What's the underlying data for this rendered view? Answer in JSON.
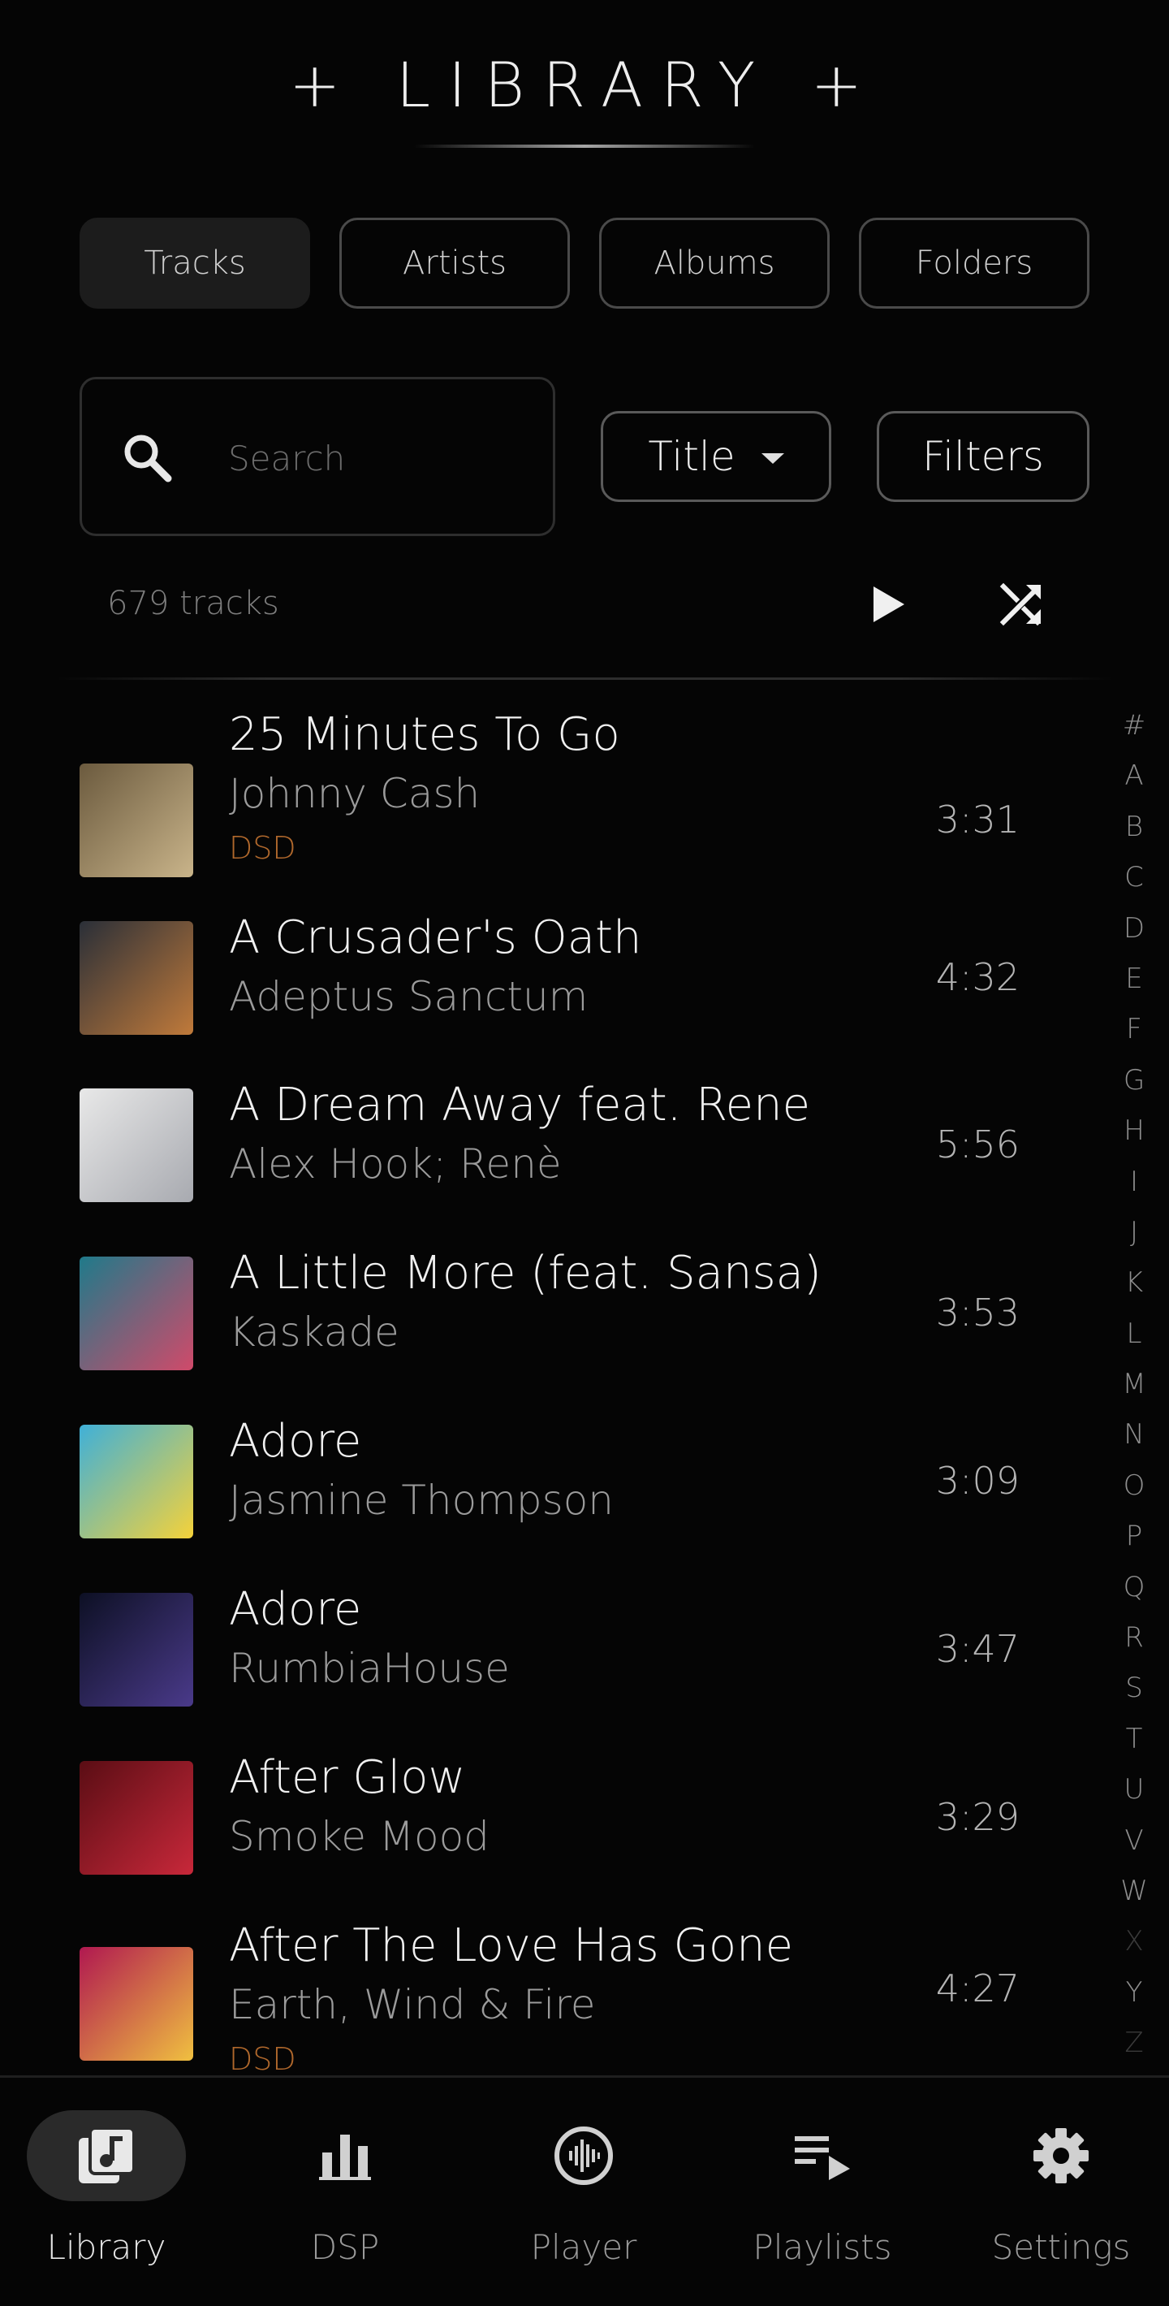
{
  "header": {
    "title": "+ LIBRARY +"
  },
  "tabs": [
    {
      "label": "Tracks",
      "active": true
    },
    {
      "label": "Artists",
      "active": false
    },
    {
      "label": "Albums",
      "active": false
    },
    {
      "label": "Folders",
      "active": false
    }
  ],
  "search": {
    "placeholder": "Search",
    "value": ""
  },
  "sort": {
    "label": "Title"
  },
  "filters": {
    "label": "Filters"
  },
  "summary": {
    "count_label": "679 tracks"
  },
  "tracks": [
    {
      "title": "25 Minutes To Go",
      "artist": "Johnny Cash",
      "badge": "DSD",
      "duration": "3:31",
      "art_colors": [
        "#6b5a3e",
        "#c9b48a"
      ]
    },
    {
      "title": "A Crusader's Oath",
      "artist": "Adeptus Sanctum",
      "badge": "",
      "duration": "4:32",
      "art_colors": [
        "#2a2f38",
        "#c07a3a"
      ]
    },
    {
      "title": "A Dream Away feat. Rene",
      "artist": "Alex Hook; Renè",
      "badge": "",
      "duration": "5:56",
      "art_colors": [
        "#e8e8e8",
        "#a8aab0"
      ]
    },
    {
      "title": "A Little More (feat. Sansa)",
      "artist": "Kaskade",
      "badge": "",
      "duration": "3:53",
      "art_colors": [
        "#1f7a8a",
        "#d04a6a"
      ]
    },
    {
      "title": "Adore",
      "artist": "Jasmine Thompson",
      "badge": "",
      "duration": "3:09",
      "art_colors": [
        "#3fb0d8",
        "#f5d23a"
      ]
    },
    {
      "title": "Adore",
      "artist": "RumbiaHouse",
      "badge": "",
      "duration": "3:47",
      "art_colors": [
        "#0d1024",
        "#4a3a8a"
      ]
    },
    {
      "title": "After Glow",
      "artist": "Smoke Mood",
      "badge": "",
      "duration": "3:29",
      "art_colors": [
        "#5a0d14",
        "#c8283a"
      ]
    },
    {
      "title": "After The Love Has Gone",
      "artist": "Earth, Wind & Fire",
      "badge": "DSD",
      "duration": "4:27",
      "art_colors": [
        "#b01850",
        "#f0c040"
      ]
    }
  ],
  "alphabet": [
    "#",
    "A",
    "B",
    "C",
    "D",
    "E",
    "F",
    "G",
    "H",
    "I",
    "J",
    "K",
    "L",
    "M",
    "N",
    "O",
    "P",
    "Q",
    "R",
    "S",
    "T",
    "U",
    "V",
    "W",
    "X",
    "Y",
    "Z"
  ],
  "alphabet_dim": [
    "X",
    "Z"
  ],
  "nav": [
    {
      "label": "Library",
      "icon": "library-music-icon",
      "active": true
    },
    {
      "label": "DSP",
      "icon": "equalizer-bars-icon",
      "active": false
    },
    {
      "label": "Player",
      "icon": "waveform-disc-icon",
      "active": false
    },
    {
      "label": "Playlists",
      "icon": "playlist-play-icon",
      "active": false
    },
    {
      "label": "Settings",
      "icon": "gear-icon",
      "active": false
    }
  ],
  "colors": {
    "accent_dsd": "#b0682c",
    "background": "#050505"
  }
}
